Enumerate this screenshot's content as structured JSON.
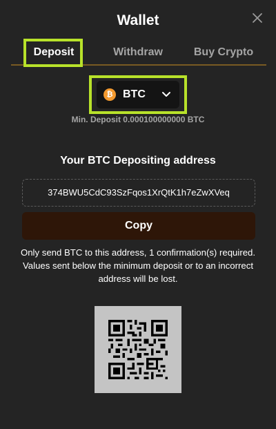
{
  "window": {
    "title": "Wallet",
    "close_icon": "close-icon"
  },
  "tabs": [
    {
      "label": "Deposit",
      "active": true
    },
    {
      "label": "Withdraw",
      "active": false
    },
    {
      "label": "Buy Crypto",
      "active": false
    }
  ],
  "currency_select": {
    "selected": "BTC",
    "icon_glyph": "₿",
    "icon": "bitcoin-icon",
    "dropdown_icon": "chevron-down-icon"
  },
  "min_deposit": "Min. Deposit 0.000100000000 BTC",
  "address_section": {
    "heading": "Your BTC Depositing address",
    "address": "374BWU5CdC93SzFqos1XrQtK1h7eZwXVeq",
    "copy_label": "Copy"
  },
  "warning": "Only send BTC to this address, 1 confirmation(s) required. Values sent below the minimum deposit or to an incorrect address will be lost.",
  "colors": {
    "background": "#242424",
    "highlight": "#b8e22a",
    "tab_underline": "#7a5b23",
    "copy_button": "#2e1608",
    "bitcoin": "#f49a2f"
  }
}
